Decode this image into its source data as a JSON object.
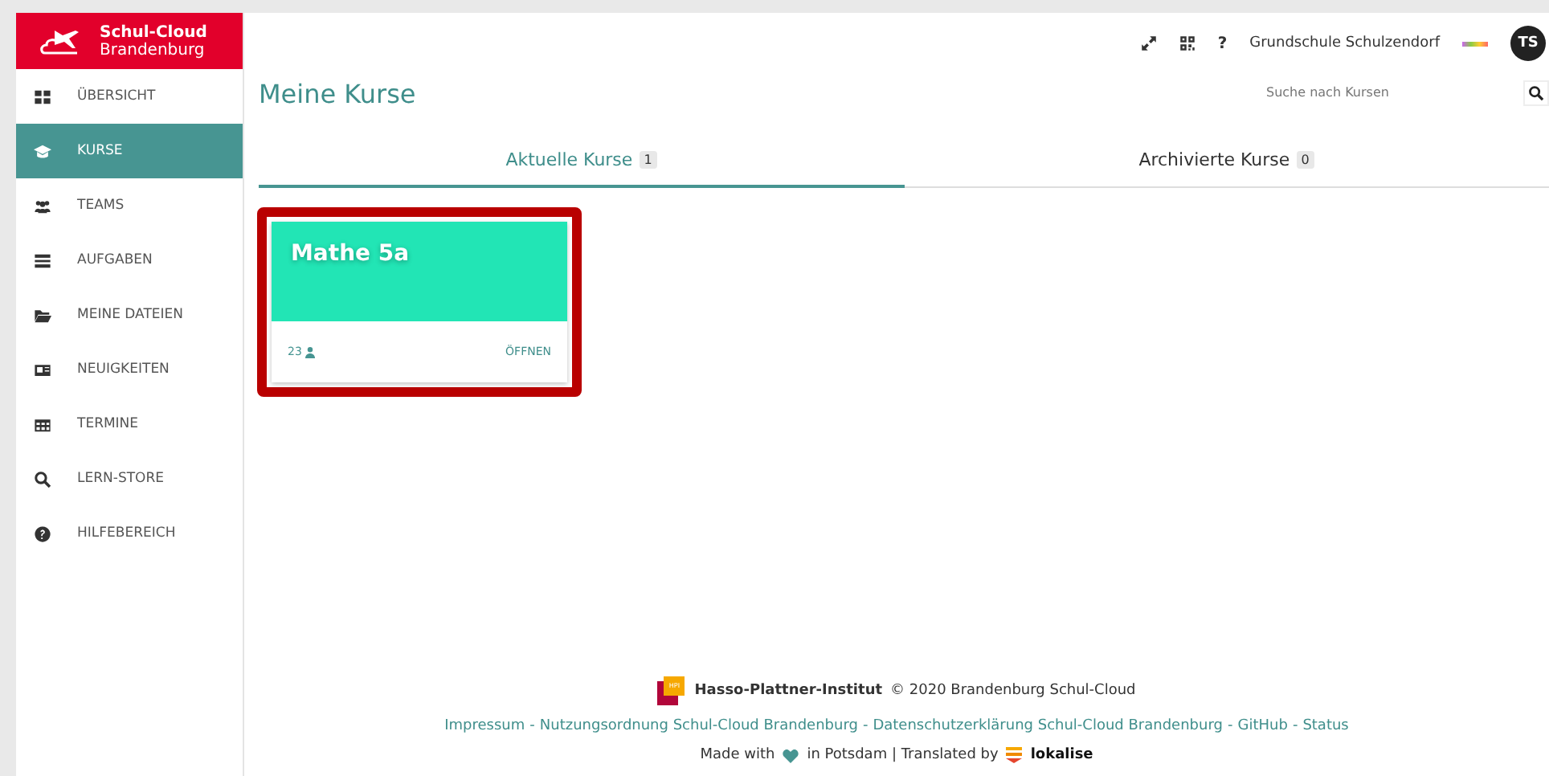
{
  "brand": {
    "line1": "Schul-Cloud",
    "line2": "Brandenburg"
  },
  "sidebar": {
    "items": [
      {
        "label": "ÜBERSICHT",
        "selected": false
      },
      {
        "label": "KURSE",
        "selected": true
      },
      {
        "label": "TEAMS",
        "selected": false
      },
      {
        "label": "AUFGABEN",
        "selected": false
      },
      {
        "label": "MEINE DATEIEN",
        "selected": false
      },
      {
        "label": "NEUIGKEITEN",
        "selected": false
      },
      {
        "label": "TERMINE",
        "selected": false
      },
      {
        "label": "LERN-STORE",
        "selected": false
      },
      {
        "label": "HILFEBEREICH",
        "selected": false
      }
    ]
  },
  "topbar": {
    "help": "?",
    "school": "Grundschule Schulzendorf",
    "avatar": "TS"
  },
  "page_title": "Meine Kurse",
  "search": {
    "placeholder": "Suche nach Kursen"
  },
  "tabs": [
    {
      "label": "Aktuelle Kurse",
      "count": "1",
      "selected": true
    },
    {
      "label": "Archivierte Kurse",
      "count": "0",
      "selected": false
    }
  ],
  "courses": [
    {
      "title": "Mathe 5a",
      "members": "23",
      "action": "ÖFFNEN",
      "color": "#22e5b5"
    }
  ],
  "footer": {
    "hpi_mark": "HPI",
    "institute": "Hasso-Plattner-Institut",
    "copyright": "© 2020 Brandenburg Schul-Cloud",
    "links": [
      "Impressum",
      "Nutzungsordnung Schul-Cloud Brandenburg",
      "Datenschutzerklärung Schul-Cloud Brandenburg",
      "GitHub",
      "Status"
    ],
    "separator": "-",
    "made_with": "Made with",
    "in_place": "in Potsdam | Translated by",
    "lokalise": "lokalise"
  }
}
